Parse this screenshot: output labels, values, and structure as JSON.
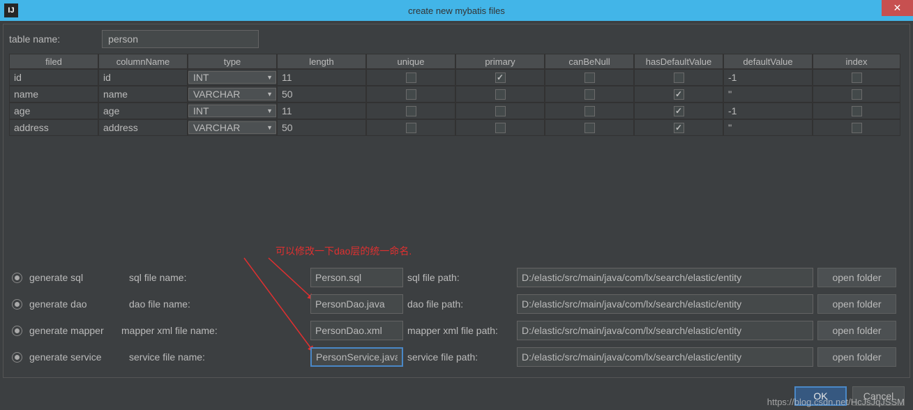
{
  "window": {
    "title": "create new mybatis files",
    "icon_text": "IJ"
  },
  "tableName": {
    "label": "table name:",
    "value": "person"
  },
  "columns": {
    "headers": [
      "filed",
      "columnName",
      "type",
      "length",
      "unique",
      "primary",
      "canBeNull",
      "hasDefaultValue",
      "defaultValue",
      "index"
    ],
    "rows": [
      {
        "filed": "id",
        "columnName": "id",
        "type": "INT",
        "length": "11",
        "unique": false,
        "primary": true,
        "canBeNull": false,
        "hasDefaultValue": false,
        "defaultValue": "-1",
        "index": false
      },
      {
        "filed": "name",
        "columnName": "name",
        "type": "VARCHAR",
        "length": "50",
        "unique": false,
        "primary": false,
        "canBeNull": false,
        "hasDefaultValue": true,
        "defaultValue": "''",
        "index": false
      },
      {
        "filed": "age",
        "columnName": "age",
        "type": "INT",
        "length": "11",
        "unique": false,
        "primary": false,
        "canBeNull": false,
        "hasDefaultValue": true,
        "defaultValue": "-1",
        "index": false
      },
      {
        "filed": "address",
        "columnName": "address",
        "type": "VARCHAR",
        "length": "50",
        "unique": false,
        "primary": false,
        "canBeNull": false,
        "hasDefaultValue": true,
        "defaultValue": "''",
        "index": false
      }
    ]
  },
  "annotation": "可以修改一下dao层的统一命名.",
  "generate": {
    "sql": {
      "label": "generate sql",
      "fileLabel": "sql file name:",
      "fileName": "Person.sql",
      "pathLabel": "sql file path:",
      "path": "D:/elastic/src/main/java/com/lx/search/elastic/entity"
    },
    "dao": {
      "label": "generate dao",
      "fileLabel": "dao file name:",
      "fileName": "PersonDao.java",
      "pathLabel": "dao file path:",
      "path": "D:/elastic/src/main/java/com/lx/search/elastic/entity"
    },
    "mapper": {
      "label": "generate mapper",
      "fileLabel": "mapper xml file name:",
      "fileName": "PersonDao.xml",
      "pathLabel": "mapper xml file path:",
      "path": "D:/elastic/src/main/java/com/lx/search/elastic/entity"
    },
    "service": {
      "label": "generate service",
      "fileLabel": "service file name:",
      "fileName": "PersonService.java",
      "pathLabel": "service file path:",
      "path": "D:/elastic/src/main/java/com/lx/search/elastic/entity"
    },
    "openFolder": "open folder"
  },
  "buttons": {
    "ok": "OK",
    "cancel": "Cancel"
  },
  "watermark": "https://blog.csdn.net/HcJsJqJSSM"
}
